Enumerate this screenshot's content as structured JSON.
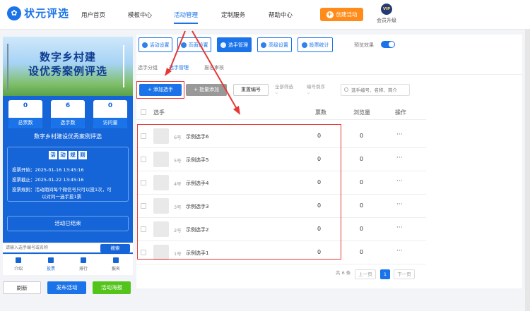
{
  "brand": {
    "logo_text": "状元评选"
  },
  "nav": {
    "items": [
      "用户首页",
      "模板中心",
      "活动管理",
      "定制服务",
      "帮助中心"
    ],
    "create_label": "创建活动",
    "vip_badge": "VIP",
    "vip_label": "会员升级"
  },
  "preview": {
    "banner_line1": "数字乡村建",
    "banner_line2": "设优秀案例评选",
    "stats": [
      {
        "value": "0",
        "label": "总票数"
      },
      {
        "value": "6",
        "label": "选手数"
      },
      {
        "value": "0",
        "label": "访问量"
      }
    ],
    "activity_title": "数字乡村建设优秀案例评选",
    "rules_chars": [
      "活",
      "动",
      "规",
      "则"
    ],
    "vote_start": "投票开始：2025-01-16 13:45:16",
    "vote_end": "投票截止：2025-01-22 13:45:16",
    "vote_rule_1": "投票规则：活动期间每个微信号只可以投1次，可",
    "vote_rule_2": "以对同一选手投1票",
    "ended_label": "活动已结束",
    "search_placeholder": "请输入选手编号或名称",
    "search_btn": "搜索",
    "tabbar": [
      {
        "label": "介绍",
        "active": false
      },
      {
        "label": "投票",
        "active": true
      },
      {
        "label": "排行",
        "active": false
      },
      {
        "label": "报名",
        "active": false
      }
    ]
  },
  "actions": {
    "refresh": "刷新",
    "publish": "发布活动",
    "poster": "活动海报"
  },
  "toolbar": {
    "buttons": [
      {
        "label": "活动设置",
        "icon": "gear-icon",
        "active": false
      },
      {
        "label": "页面设置",
        "icon": "page-icon",
        "active": false
      },
      {
        "label": "选手管理",
        "icon": "users-icon",
        "active": true
      },
      {
        "label": "高级设置",
        "icon": "sliders-icon",
        "active": false
      },
      {
        "label": "投票统计",
        "icon": "chart-icon",
        "active": false
      }
    ],
    "preview_label": "预览效果",
    "preview_on": true
  },
  "subtabs": [
    {
      "label": "选手分组",
      "active": false
    },
    {
      "label": "选手管理",
      "active": true
    },
    {
      "label": "报名审核",
      "active": false
    }
  ],
  "list_actions": {
    "add": "+ 添加选手",
    "batch": "+ 批量添加",
    "reorder": "重置编号",
    "filter1_line1": "全部筛选",
    "filter1_line2": "⌵",
    "filter2_line1": "编号倒序",
    "filter2_line2": "⌵",
    "search_placeholder": "选手编号、名称、简介"
  },
  "table": {
    "headers": [
      "选手",
      "票数",
      "浏览量",
      "操作"
    ],
    "rows": [
      {
        "num": "6号",
        "name": "示例选手6",
        "votes": "0",
        "views": "0",
        "ops": "···"
      },
      {
        "num": "5号",
        "name": "示例选手5",
        "votes": "0",
        "views": "0",
        "ops": "···"
      },
      {
        "num": "4号",
        "name": "示例选手4",
        "votes": "0",
        "views": "0",
        "ops": "···"
      },
      {
        "num": "3号",
        "name": "示例选手3",
        "votes": "0",
        "views": "0",
        "ops": "···"
      },
      {
        "num": "2号",
        "name": "示例选手2",
        "votes": "0",
        "views": "0",
        "ops": "···"
      },
      {
        "num": "1号",
        "name": "示例选手1",
        "votes": "0",
        "views": "0",
        "ops": "···"
      }
    ]
  },
  "pager": {
    "total": "共 6 条",
    "prev": "上一页",
    "current": "1",
    "next": "下一页"
  },
  "colors": {
    "accent": "#1a73e8",
    "annotation": "#e53935",
    "orange": "#ff8c1a",
    "green": "#52c41a"
  }
}
